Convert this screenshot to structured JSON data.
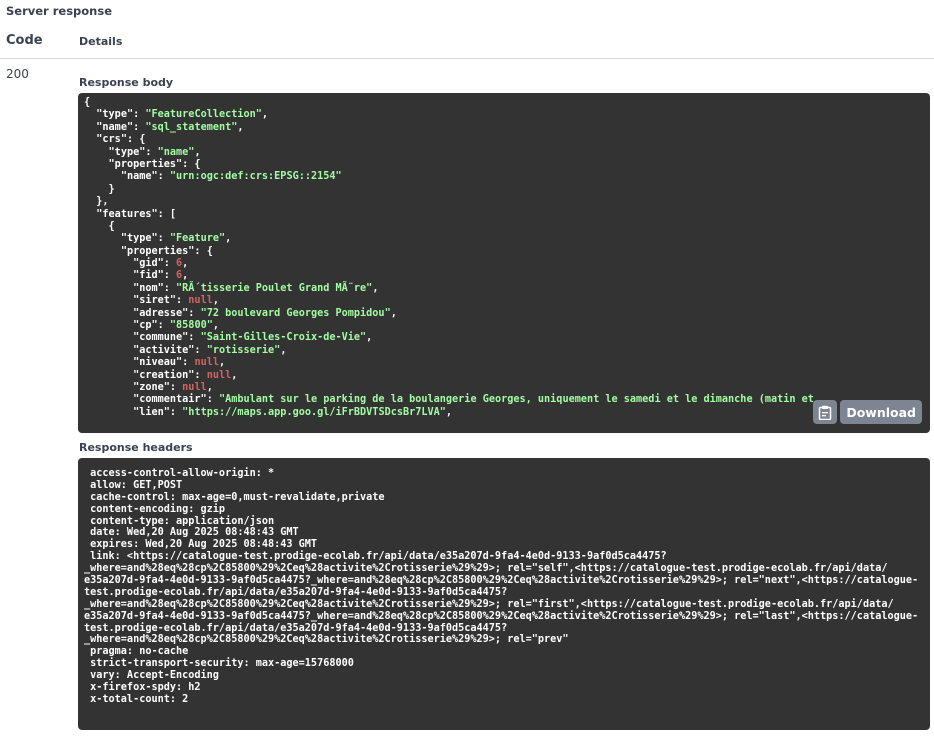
{
  "server_response_title": "Server response",
  "columns": {
    "code": "Code",
    "details": "Details"
  },
  "status_code": "200",
  "response_body_label": "Response body",
  "response_headers_label": "Response headers",
  "download_label": "Download",
  "body_lines": [
    [
      [
        "p",
        "{"
      ]
    ],
    [
      [
        "p",
        "  "
      ],
      [
        "k",
        "\"type\""
      ],
      [
        "p",
        ": "
      ],
      [
        "s",
        "\"FeatureCollection\""
      ],
      [
        "p",
        ","
      ]
    ],
    [
      [
        "p",
        "  "
      ],
      [
        "k",
        "\"name\""
      ],
      [
        "p",
        ": "
      ],
      [
        "s",
        "\"sql_statement\""
      ],
      [
        "p",
        ","
      ]
    ],
    [
      [
        "p",
        "  "
      ],
      [
        "k",
        "\"crs\""
      ],
      [
        "p",
        ": {"
      ]
    ],
    [
      [
        "p",
        "    "
      ],
      [
        "k",
        "\"type\""
      ],
      [
        "p",
        ": "
      ],
      [
        "s",
        "\"name\""
      ],
      [
        "p",
        ","
      ]
    ],
    [
      [
        "p",
        "    "
      ],
      [
        "k",
        "\"properties\""
      ],
      [
        "p",
        ": {"
      ]
    ],
    [
      [
        "p",
        "      "
      ],
      [
        "k",
        "\"name\""
      ],
      [
        "p",
        ": "
      ],
      [
        "s",
        "\"urn:ogc:def:crs:EPSG::2154\""
      ]
    ],
    [
      [
        "p",
        "    }"
      ]
    ],
    [
      [
        "p",
        "  },"
      ]
    ],
    [
      [
        "p",
        "  "
      ],
      [
        "k",
        "\"features\""
      ],
      [
        "p",
        ": ["
      ]
    ],
    [
      [
        "p",
        "    {"
      ]
    ],
    [
      [
        "p",
        "      "
      ],
      [
        "k",
        "\"type\""
      ],
      [
        "p",
        ": "
      ],
      [
        "s",
        "\"Feature\""
      ],
      [
        "p",
        ","
      ]
    ],
    [
      [
        "p",
        "      "
      ],
      [
        "k",
        "\"properties\""
      ],
      [
        "p",
        ": {"
      ]
    ],
    [
      [
        "p",
        "        "
      ],
      [
        "k",
        "\"gid\""
      ],
      [
        "p",
        ": "
      ],
      [
        "n",
        "6"
      ],
      [
        "p",
        ","
      ]
    ],
    [
      [
        "p",
        "        "
      ],
      [
        "k",
        "\"fid\""
      ],
      [
        "p",
        ": "
      ],
      [
        "n",
        "6"
      ],
      [
        "p",
        ","
      ]
    ],
    [
      [
        "p",
        "        "
      ],
      [
        "k",
        "\"nom\""
      ],
      [
        "p",
        ": "
      ],
      [
        "s",
        "\"RÃ´tisserie Poulet Grand MÃ¨re\""
      ],
      [
        "p",
        ","
      ]
    ],
    [
      [
        "p",
        "        "
      ],
      [
        "k",
        "\"siret\""
      ],
      [
        "p",
        ": "
      ],
      [
        "n",
        "null"
      ],
      [
        "p",
        ","
      ]
    ],
    [
      [
        "p",
        "        "
      ],
      [
        "k",
        "\"adresse\""
      ],
      [
        "p",
        ": "
      ],
      [
        "s",
        "\"72 boulevard Georges Pompidou\""
      ],
      [
        "p",
        ","
      ]
    ],
    [
      [
        "p",
        "        "
      ],
      [
        "k",
        "\"cp\""
      ],
      [
        "p",
        ": "
      ],
      [
        "s",
        "\"85800\""
      ],
      [
        "p",
        ","
      ]
    ],
    [
      [
        "p",
        "        "
      ],
      [
        "k",
        "\"commune\""
      ],
      [
        "p",
        ": "
      ],
      [
        "s",
        "\"Saint-Gilles-Croix-de-Vie\""
      ],
      [
        "p",
        ","
      ]
    ],
    [
      [
        "p",
        "        "
      ],
      [
        "k",
        "\"activite\""
      ],
      [
        "p",
        ": "
      ],
      [
        "s",
        "\"rotisserie\""
      ],
      [
        "p",
        ","
      ]
    ],
    [
      [
        "p",
        "        "
      ],
      [
        "k",
        "\"niveau\""
      ],
      [
        "p",
        ": "
      ],
      [
        "n",
        "null"
      ],
      [
        "p",
        ","
      ]
    ],
    [
      [
        "p",
        "        "
      ],
      [
        "k",
        "\"creation\""
      ],
      [
        "p",
        ": "
      ],
      [
        "n",
        "null"
      ],
      [
        "p",
        ","
      ]
    ],
    [
      [
        "p",
        "        "
      ],
      [
        "k",
        "\"zone\""
      ],
      [
        "p",
        ": "
      ],
      [
        "n",
        "null"
      ],
      [
        "p",
        ","
      ]
    ],
    [
      [
        "p",
        "        "
      ],
      [
        "k",
        "\"commentair\""
      ],
      [
        "p",
        ": "
      ],
      [
        "s",
        "\"Ambulant sur le parking de la boulangerie Georges, uniquement le samedi et le dimanche (matin et"
      ]
    ],
    [
      [
        "p",
        "        "
      ],
      [
        "k",
        "\"lien\""
      ],
      [
        "p",
        ": "
      ],
      [
        "s",
        "\"https://maps.app.goo.gl/iFrBDVTSDcsBr7LVA\""
      ],
      [
        "p",
        ","
      ]
    ]
  ],
  "header_lines": [
    " access-control-allow-origin: *",
    " allow: GET,POST",
    " cache-control: max-age=0,must-revalidate,private",
    " content-encoding: gzip",
    " content-type: application/json",
    " date: Wed,20 Aug 2025 08:48:43 GMT",
    " expires: Wed,20 Aug 2025 08:48:43 GMT",
    " link: <https://catalogue-test.prodige-ecolab.fr/api/data/e35a207d-9fa4-4e0d-9133-9af0d5ca4475?",
    "_where=and%28eq%28cp%2C85800%29%2Ceq%28activite%2Crotisserie%29%29>; rel=\"self\",<https://catalogue-test.prodige-ecolab.fr/api/data/",
    "e35a207d-9fa4-4e0d-9133-9af0d5ca4475?_where=and%28eq%28cp%2C85800%29%2Ceq%28activite%2Crotisserie%29%29>; rel=\"next\",<https://catalogue-",
    "test.prodige-ecolab.fr/api/data/e35a207d-9fa4-4e0d-9133-9af0d5ca4475?",
    "_where=and%28eq%28cp%2C85800%29%2Ceq%28activite%2Crotisserie%29%29>; rel=\"first\",<https://catalogue-test.prodige-ecolab.fr/api/data/",
    "e35a207d-9fa4-4e0d-9133-9af0d5ca4475?_where=and%28eq%28cp%2C85800%29%2Ceq%28activite%2Crotisserie%29%29>; rel=\"last\",<https://catalogue-",
    "test.prodige-ecolab.fr/api/data/e35a207d-9fa4-4e0d-9133-9af0d5ca4475?",
    "_where=and%28eq%28cp%2C85800%29%2Ceq%28activite%2Crotisserie%29%29>; rel=\"prev\"",
    " pragma: no-cache",
    " strict-transport-security: max-age=15768000",
    " vary: Accept-Encoding",
    " x-firefox-spdy: h2",
    " x-total-count: 2"
  ],
  "colors": {
    "code_bg": "#333333",
    "string": "#a2fca2",
    "number": "#d36363",
    "button_bg": "#7d8492"
  }
}
